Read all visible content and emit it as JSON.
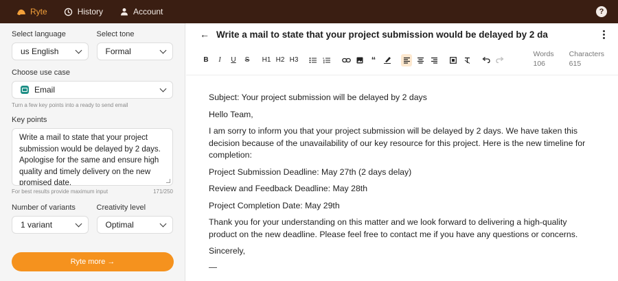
{
  "nav": {
    "items": [
      {
        "label": "Ryte",
        "icon": "ryte-logo-icon",
        "active": true
      },
      {
        "label": "History",
        "icon": "history-icon",
        "active": false
      },
      {
        "label": "Account",
        "icon": "user-icon",
        "active": false
      }
    ],
    "help_icon": "help-icon"
  },
  "left": {
    "language_label": "Select language",
    "language_value": "us English",
    "tone_label": "Select tone",
    "tone_value": "Formal",
    "usecase_label": "Choose use case",
    "usecase_value": "Email",
    "usecase_hint": "Turn a few key points into a ready to send email",
    "keypoints_label": "Key points",
    "keypoints_value": "Write a mail to state that your project submission would be delayed by 2 days. Apologise for the same and ensure high quality and timely delivery on the new promised date.",
    "keypoints_hint": "For best results provide maximum input",
    "keypoints_count": "171/250",
    "variants_label": "Number of variants",
    "variants_value": "1 variant",
    "creativity_label": "Creativity level",
    "creativity_value": "Optimal",
    "ryte_button": "Ryte more →"
  },
  "editor": {
    "title": "Write a mail to state that your project submission would be delayed by 2 da",
    "toolbar": {
      "bold": "B",
      "italic": "I",
      "underline": "U",
      "strike": "S",
      "h1": "H1",
      "h2": "H2",
      "h3": "H3"
    },
    "words_label": "Words",
    "words_value": "106",
    "chars_label": "Characters",
    "chars_value": "615",
    "paragraphs": [
      "Subject: Your project submission will be delayed by 2 days",
      "Hello Team,",
      "I am sorry to inform you that your project submission will be delayed by 2 days. We have taken this decision because of the unavailability of our key resource for this project. Here is the new timeline for completion:",
      "Project Submission Deadline: May 27th (2 days delay)",
      "Review and Feedback Deadline: May 28th",
      "Project Completion Date: May 29th",
      "Thank you for your understanding on this matter and we look forward to delivering a high-quality product on the new deadline. Please feel free to contact me if you have any questions or concerns.",
      "Sincerely,"
    ]
  },
  "colors": {
    "topbar": "#3a1e12",
    "accent": "#f5921e",
    "active_nav": "#f3a03a"
  }
}
